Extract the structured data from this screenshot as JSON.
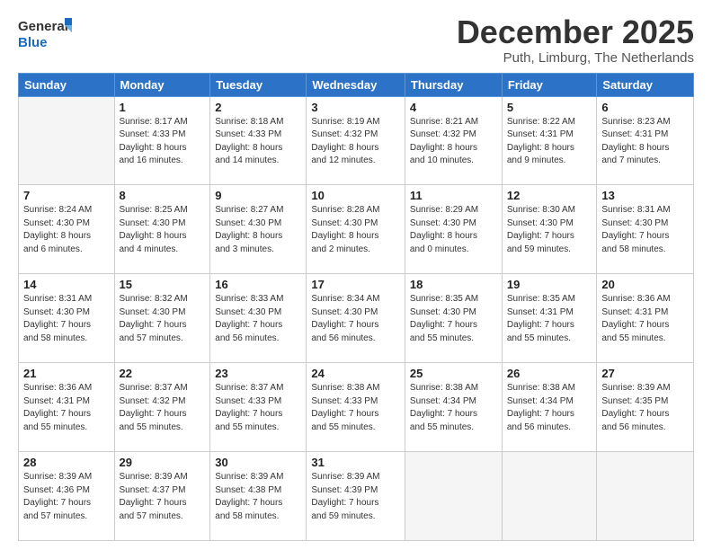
{
  "logo": {
    "line1": "General",
    "line2": "Blue"
  },
  "title": "December 2025",
  "subtitle": "Puth, Limburg, The Netherlands",
  "headers": [
    "Sunday",
    "Monday",
    "Tuesday",
    "Wednesday",
    "Thursday",
    "Friday",
    "Saturday"
  ],
  "weeks": [
    [
      {
        "day": "",
        "info": ""
      },
      {
        "day": "1",
        "info": "Sunrise: 8:17 AM\nSunset: 4:33 PM\nDaylight: 8 hours\nand 16 minutes."
      },
      {
        "day": "2",
        "info": "Sunrise: 8:18 AM\nSunset: 4:33 PM\nDaylight: 8 hours\nand 14 minutes."
      },
      {
        "day": "3",
        "info": "Sunrise: 8:19 AM\nSunset: 4:32 PM\nDaylight: 8 hours\nand 12 minutes."
      },
      {
        "day": "4",
        "info": "Sunrise: 8:21 AM\nSunset: 4:32 PM\nDaylight: 8 hours\nand 10 minutes."
      },
      {
        "day": "5",
        "info": "Sunrise: 8:22 AM\nSunset: 4:31 PM\nDaylight: 8 hours\nand 9 minutes."
      },
      {
        "day": "6",
        "info": "Sunrise: 8:23 AM\nSunset: 4:31 PM\nDaylight: 8 hours\nand 7 minutes."
      }
    ],
    [
      {
        "day": "7",
        "info": "Sunrise: 8:24 AM\nSunset: 4:30 PM\nDaylight: 8 hours\nand 6 minutes."
      },
      {
        "day": "8",
        "info": "Sunrise: 8:25 AM\nSunset: 4:30 PM\nDaylight: 8 hours\nand 4 minutes."
      },
      {
        "day": "9",
        "info": "Sunrise: 8:27 AM\nSunset: 4:30 PM\nDaylight: 8 hours\nand 3 minutes."
      },
      {
        "day": "10",
        "info": "Sunrise: 8:28 AM\nSunset: 4:30 PM\nDaylight: 8 hours\nand 2 minutes."
      },
      {
        "day": "11",
        "info": "Sunrise: 8:29 AM\nSunset: 4:30 PM\nDaylight: 8 hours\nand 0 minutes."
      },
      {
        "day": "12",
        "info": "Sunrise: 8:30 AM\nSunset: 4:30 PM\nDaylight: 7 hours\nand 59 minutes."
      },
      {
        "day": "13",
        "info": "Sunrise: 8:31 AM\nSunset: 4:30 PM\nDaylight: 7 hours\nand 58 minutes."
      }
    ],
    [
      {
        "day": "14",
        "info": "Sunrise: 8:31 AM\nSunset: 4:30 PM\nDaylight: 7 hours\nand 58 minutes."
      },
      {
        "day": "15",
        "info": "Sunrise: 8:32 AM\nSunset: 4:30 PM\nDaylight: 7 hours\nand 57 minutes."
      },
      {
        "day": "16",
        "info": "Sunrise: 8:33 AM\nSunset: 4:30 PM\nDaylight: 7 hours\nand 56 minutes."
      },
      {
        "day": "17",
        "info": "Sunrise: 8:34 AM\nSunset: 4:30 PM\nDaylight: 7 hours\nand 56 minutes."
      },
      {
        "day": "18",
        "info": "Sunrise: 8:35 AM\nSunset: 4:30 PM\nDaylight: 7 hours\nand 55 minutes."
      },
      {
        "day": "19",
        "info": "Sunrise: 8:35 AM\nSunset: 4:31 PM\nDaylight: 7 hours\nand 55 minutes."
      },
      {
        "day": "20",
        "info": "Sunrise: 8:36 AM\nSunset: 4:31 PM\nDaylight: 7 hours\nand 55 minutes."
      }
    ],
    [
      {
        "day": "21",
        "info": "Sunrise: 8:36 AM\nSunset: 4:31 PM\nDaylight: 7 hours\nand 55 minutes."
      },
      {
        "day": "22",
        "info": "Sunrise: 8:37 AM\nSunset: 4:32 PM\nDaylight: 7 hours\nand 55 minutes."
      },
      {
        "day": "23",
        "info": "Sunrise: 8:37 AM\nSunset: 4:33 PM\nDaylight: 7 hours\nand 55 minutes."
      },
      {
        "day": "24",
        "info": "Sunrise: 8:38 AM\nSunset: 4:33 PM\nDaylight: 7 hours\nand 55 minutes."
      },
      {
        "day": "25",
        "info": "Sunrise: 8:38 AM\nSunset: 4:34 PM\nDaylight: 7 hours\nand 55 minutes."
      },
      {
        "day": "26",
        "info": "Sunrise: 8:38 AM\nSunset: 4:34 PM\nDaylight: 7 hours\nand 56 minutes."
      },
      {
        "day": "27",
        "info": "Sunrise: 8:39 AM\nSunset: 4:35 PM\nDaylight: 7 hours\nand 56 minutes."
      }
    ],
    [
      {
        "day": "28",
        "info": "Sunrise: 8:39 AM\nSunset: 4:36 PM\nDaylight: 7 hours\nand 57 minutes."
      },
      {
        "day": "29",
        "info": "Sunrise: 8:39 AM\nSunset: 4:37 PM\nDaylight: 7 hours\nand 57 minutes."
      },
      {
        "day": "30",
        "info": "Sunrise: 8:39 AM\nSunset: 4:38 PM\nDaylight: 7 hours\nand 58 minutes."
      },
      {
        "day": "31",
        "info": "Sunrise: 8:39 AM\nSunset: 4:39 PM\nDaylight: 7 hours\nand 59 minutes."
      },
      {
        "day": "",
        "info": ""
      },
      {
        "day": "",
        "info": ""
      },
      {
        "day": "",
        "info": ""
      }
    ]
  ]
}
